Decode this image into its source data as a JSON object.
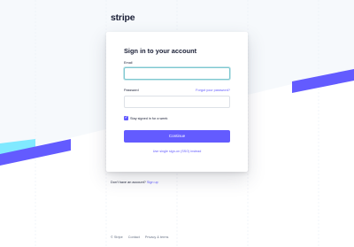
{
  "brand": {
    "logo": "stripe"
  },
  "form": {
    "title": "Sign in to your account",
    "email_label": "Email",
    "email_value": "",
    "password_label": "Password",
    "forgot_link": "Forgot your password?",
    "password_value": "",
    "stay_signed_in": "Stay signed in for a week",
    "stay_signed_in_checked": true,
    "continue_button": "Continue",
    "sso_link": "Use single sign-on (SSO) instead"
  },
  "signup": {
    "prompt": "Don't have an account?",
    "link": "Sign up"
  },
  "footer": {
    "copyright": "© Stripe",
    "contact": "Contact",
    "privacy": "Privacy & terms"
  },
  "colors": {
    "accent": "#635bff",
    "cyan": "#80e9ff",
    "text": "#1a1f36",
    "muted": "#697386"
  }
}
